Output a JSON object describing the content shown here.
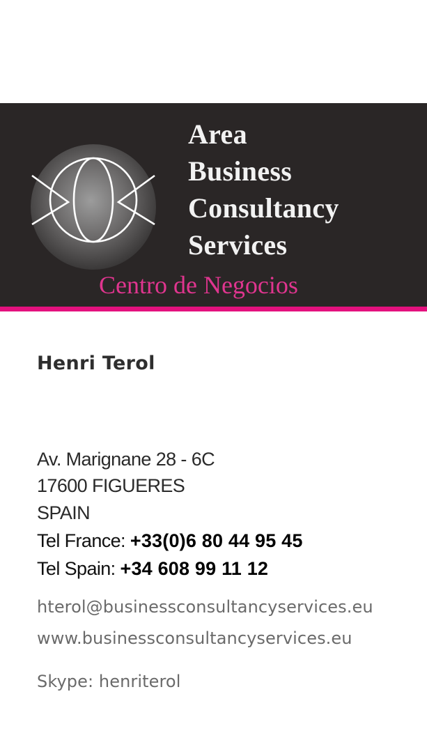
{
  "brand": {
    "lines": [
      "Area",
      "Business",
      "Consultancy",
      "Services"
    ],
    "tagline": "Centro de Negocios",
    "colors": {
      "banner": "#2a2626",
      "accent": "#e3117e"
    },
    "logo_icon": "orbit-sphere-logo"
  },
  "person": {
    "name": "Henri Terol"
  },
  "address": {
    "street": "Av. Marignane 28 - 6C",
    "city": "17600 FIGUERES",
    "country": "SPAIN"
  },
  "phones": {
    "france_label": "Tel France: ",
    "france_number": "+33(0)6 80 44 95 45",
    "spain_label": "Tel Spain: ",
    "spain_number": "+34 608 99 11 12"
  },
  "contact": {
    "email": "hterol@businessconsultancyservices.eu",
    "website": "www.businessconsultancyservices.eu",
    "skype": "Skype: henriterol"
  }
}
